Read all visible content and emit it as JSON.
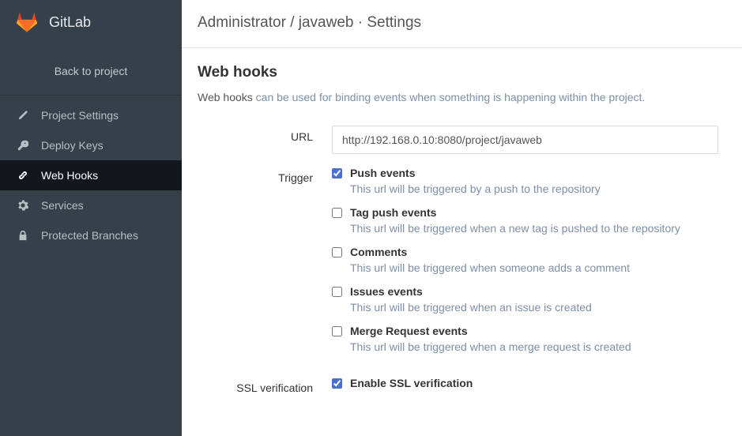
{
  "brand": "GitLab",
  "back_link": "Back to project",
  "nav": [
    {
      "label": "Project Settings"
    },
    {
      "label": "Deploy Keys"
    },
    {
      "label": "Web Hooks"
    },
    {
      "label": "Services"
    },
    {
      "label": "Protected Branches"
    }
  ],
  "breadcrumb": {
    "owner": "Administrator",
    "project": "javaweb",
    "page": "Settings"
  },
  "section": {
    "title": "Web hooks",
    "desc_prefix": "Web hooks ",
    "desc_muted": "can be used for binding events when something is happening within the project."
  },
  "form": {
    "url_label": "URL",
    "url_value": "http://192.168.0.10:8080/project/javaweb",
    "trigger_label": "Trigger",
    "triggers": [
      {
        "title": "Push events",
        "desc": "This url will be triggered by a push to the repository",
        "checked": true
      },
      {
        "title": "Tag push events",
        "desc": "This url will be triggered when a new tag is pushed to the repository",
        "checked": false
      },
      {
        "title": "Comments",
        "desc": "This url will be triggered when someone adds a comment",
        "checked": false
      },
      {
        "title": "Issues events",
        "desc": "This url will be triggered when an issue is created",
        "checked": false
      },
      {
        "title": "Merge Request events",
        "desc": "This url will be triggered when a merge request is created",
        "checked": false
      }
    ],
    "ssl_label": "SSL verification",
    "ssl_checkbox_label": "Enable SSL verification",
    "ssl_checked": true
  }
}
